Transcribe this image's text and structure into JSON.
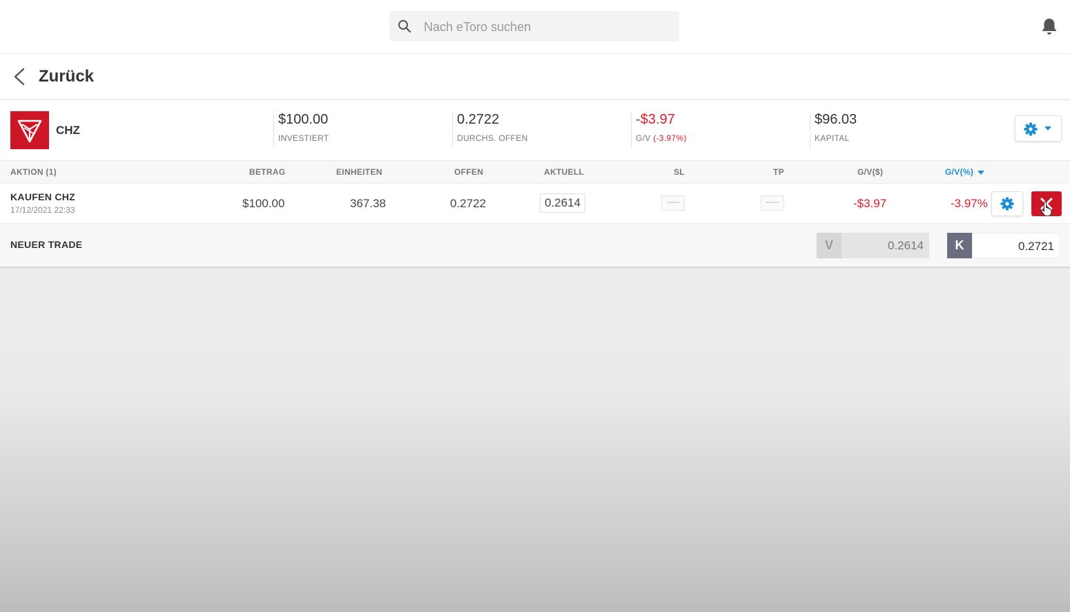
{
  "search": {
    "placeholder": "Nach eToro suchen"
  },
  "nav": {
    "back_label": "Zurück"
  },
  "summary": {
    "ticker": "CHZ",
    "invested": {
      "value": "$100.00",
      "label": "INVESTIERT"
    },
    "avg_open": {
      "value": "0.2722",
      "label": "DURCHS. OFFEN"
    },
    "pnl": {
      "value": "-$3.97",
      "label": "G/V",
      "percent": "(-3.97%)"
    },
    "equity": {
      "value": "$96.03",
      "label": "KAPITAL"
    }
  },
  "table": {
    "headers": {
      "action": "AKTION (1)",
      "amount": "BETRAG",
      "units": "EINHEITEN",
      "open": "OFFEN",
      "current": "AKTUELL",
      "sl": "SL",
      "tp": "TP",
      "pnl_usd": "G/V($)",
      "pnl_pct": "G/V(%)"
    },
    "rows": [
      {
        "action": "KAUFEN CHZ",
        "date": "17/12/2021 22:33",
        "amount": "$100.00",
        "units": "367.38",
        "open": "0.2722",
        "current": "0.2614",
        "sl": "-----",
        "tp": "-----",
        "pnl_usd": "-$3.97",
        "pnl_pct": "-3.97%"
      }
    ]
  },
  "new_trade": {
    "label": "NEUER TRADE",
    "sell_tag": "V",
    "sell_price": "0.2614",
    "buy_tag": "K",
    "buy_price": "0.2721"
  },
  "colors": {
    "accent_red": "#cd1626",
    "loss_red": "#d61f2c",
    "accent_blue": "#1a8fd6",
    "buy_tag": "#6b6e7e"
  },
  "icons": [
    "search-icon",
    "bell-icon",
    "back-chevron-icon",
    "chz-logo",
    "gear-icon",
    "caret-down-icon",
    "close-icon",
    "cursor-icon"
  ]
}
